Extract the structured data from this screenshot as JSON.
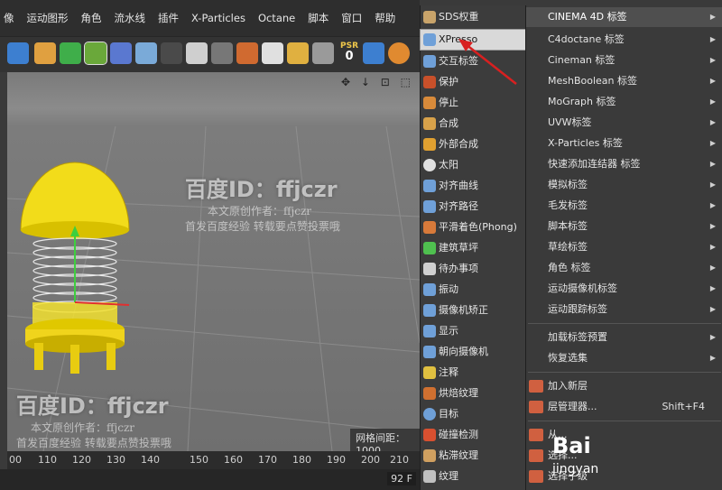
{
  "menubar": [
    "像",
    "运动图形",
    "角色",
    "流水线",
    "插件",
    "X-Particles",
    "Octane",
    "脚本",
    "窗口",
    "帮助"
  ],
  "psr": {
    "label": "PSR",
    "value": "0"
  },
  "viewport": {
    "grid_spacing": "网格间距：1000"
  },
  "timeline": {
    "ticks": [
      "00",
      "110",
      "120",
      "130",
      "140",
      "150",
      "160",
      "170",
      "180",
      "190",
      "200",
      "210"
    ],
    "frame": "92 F"
  },
  "watermark": {
    "id": "百度ID：ffjczr",
    "author": "本文原创作者：ffjczr",
    "notice": "首发百度经验 转载要点赞投票哦"
  },
  "tags_menu": [
    {
      "label": "SDS权重",
      "icon_color": "#c9a46a"
    },
    {
      "label": "XPresso",
      "icon_color": "#6fa0d8",
      "highlight": true
    },
    {
      "label": "交互标签",
      "icon_color": "#6fa0d8"
    },
    {
      "label": "保护",
      "icon_color": "#c8502a"
    },
    {
      "label": "停止",
      "icon_color": "#d88a3a"
    },
    {
      "label": "合成",
      "icon_color": "#d8a24a"
    },
    {
      "label": "外部合成",
      "icon_color": "#e0a030"
    },
    {
      "label": "太阳",
      "icon_color": "#e0e0e0"
    },
    {
      "label": "对齐曲线",
      "icon_color": "#6fa0d8"
    },
    {
      "label": "对齐路径",
      "icon_color": "#6fa0d8"
    },
    {
      "label": "平滑着色(Phong)",
      "icon_color": "#d87a3a"
    },
    {
      "label": "建筑草坪",
      "icon_color": "#4fc04f"
    },
    {
      "label": "待办事项",
      "icon_color": "#d0d0d0"
    },
    {
      "label": "振动",
      "icon_color": "#6fa0d8"
    },
    {
      "label": "摄像机矫正",
      "icon_color": "#6fa0d8"
    },
    {
      "label": "显示",
      "icon_color": "#6fa0d8"
    },
    {
      "label": "朝向摄像机",
      "icon_color": "#6fa0d8"
    },
    {
      "label": "注释",
      "icon_color": "#e0c040"
    },
    {
      "label": "烘焙纹理",
      "icon_color": "#d07030"
    },
    {
      "label": "目标",
      "icon_color": "#6fa0d8"
    },
    {
      "label": "碰撞检测",
      "icon_color": "#d85030"
    },
    {
      "label": "粘滞纹理",
      "icon_color": "#d0a060"
    },
    {
      "label": "纹理",
      "icon_color": "#c0c0c0"
    }
  ],
  "submenu": [
    {
      "label": "CINEMA 4D 标签",
      "arrow": true,
      "first": true
    },
    {
      "label": "C4doctane 标签",
      "arrow": true
    },
    {
      "label": "Cineman 标签",
      "arrow": true
    },
    {
      "label": "MeshBoolean 标签",
      "arrow": true
    },
    {
      "label": "MoGraph 标签",
      "arrow": true
    },
    {
      "label": "UVW标签",
      "arrow": true
    },
    {
      "label": "X-Particles 标签",
      "arrow": true
    },
    {
      "label": "快速添加连结器 标签",
      "arrow": true
    },
    {
      "label": "模拟标签",
      "arrow": true
    },
    {
      "label": "毛发标签",
      "arrow": true
    },
    {
      "label": "脚本标签",
      "arrow": true
    },
    {
      "label": "草绘标签",
      "arrow": true
    },
    {
      "label": "角色 标签",
      "arrow": true
    },
    {
      "label": "运动摄像机标签",
      "arrow": true
    },
    {
      "label": "运动跟踪标签",
      "arrow": true
    },
    {
      "label": "加载标签预置",
      "arrow": true,
      "gap_before": true
    },
    {
      "label": "恢复选集",
      "arrow": true
    },
    {
      "label": "加入新层",
      "icon": true,
      "gap_before": true
    },
    {
      "label": "层管理器...",
      "icon": true,
      "shortcut": "Shift+F4"
    },
    {
      "label": "从...",
      "icon": true,
      "gap_before": true
    },
    {
      "label": "选择...",
      "icon": true
    },
    {
      "label": "选择子级",
      "icon": true
    }
  ],
  "brand": {
    "name": "Bai",
    "sub": "jingyan"
  }
}
